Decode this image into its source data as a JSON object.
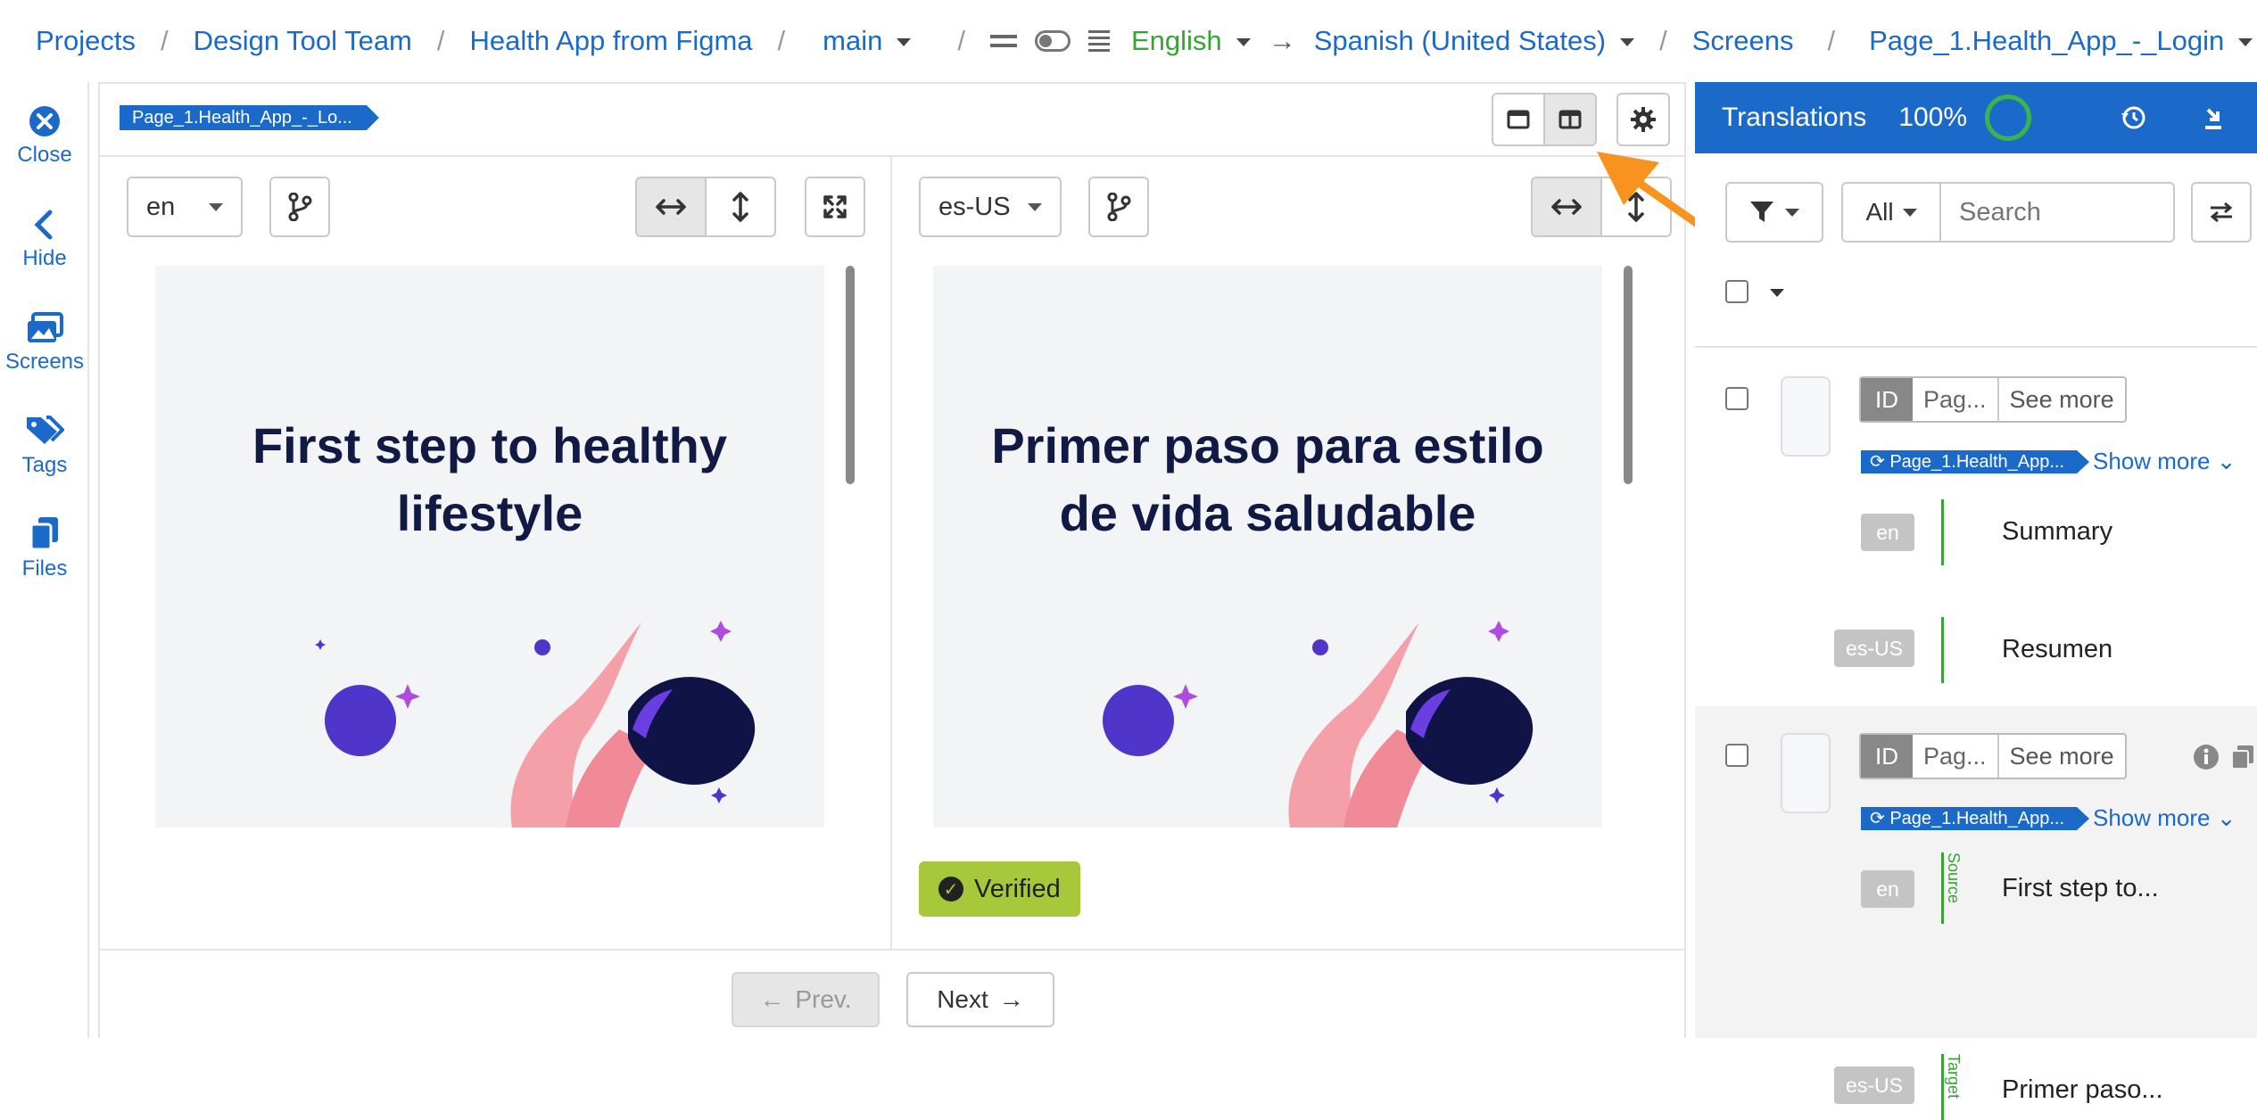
{
  "breadcrumb": {
    "projects": "Projects",
    "team": "Design Tool Team",
    "app": "Health App from Figma",
    "branch": "main",
    "source_language": "English",
    "target_language": "Spanish (United States)",
    "screens": "Screens",
    "screen_name": "Page_1.Health_App_-_Login"
  },
  "leftnav": {
    "close": "Close",
    "hide": "Hide",
    "screens": "Screens",
    "tags": "Tags",
    "files": "Files"
  },
  "editor": {
    "screen_tag": "Page_1.Health_App_-_Lo...",
    "left_lang": "en",
    "right_lang": "es-US",
    "left_title": "First step to healthy lifestyle",
    "right_title": "Primer paso para estilo de vida saludable",
    "verified_label": "Verified",
    "prev_label": "Prev.",
    "next_label": "Next"
  },
  "translations": {
    "title": "Translations",
    "progress": "100%",
    "filter_all": "All",
    "search_placeholder": "Search",
    "rows": [
      {
        "id_label": "ID",
        "id_value": "Pag...",
        "see_more": "See more",
        "screen_tag": "Page_1.Health_App...",
        "show_more": "Show more",
        "source_lang": "en",
        "source_text": "Summary",
        "target_lang": "es-US",
        "target_text": "Resumen"
      },
      {
        "id_label": "ID",
        "id_value": "Pag...",
        "see_more": "See more",
        "screen_tag": "Page_1.Health_App...",
        "show_more": "Show more",
        "source_lang": "en",
        "source_text": "First step to...",
        "source_marker": "Source",
        "target_lang": "es-US",
        "target_text": "Primer paso...",
        "target_marker": "Target"
      }
    ]
  },
  "colors": {
    "accent": "#1b6ac9",
    "verified": "#a7c83b",
    "success": "#3aa335",
    "highlight_arrow": "#f7931e"
  }
}
